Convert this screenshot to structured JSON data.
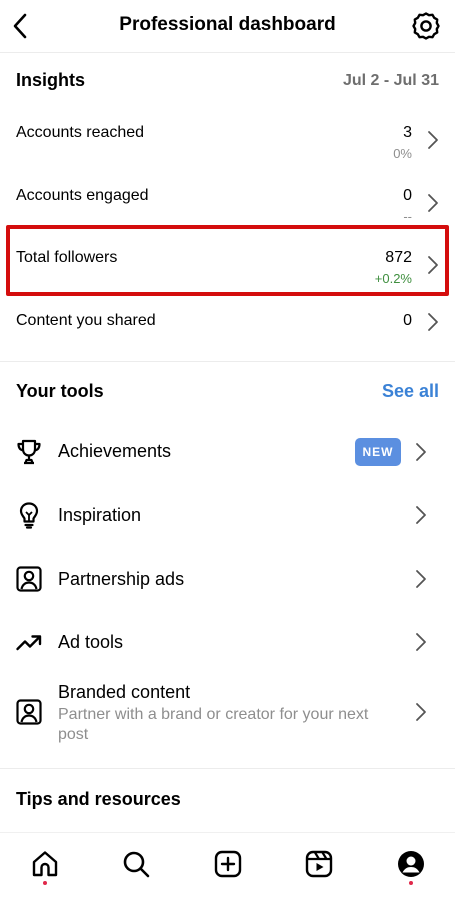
{
  "header": {
    "title": "Professional dashboard"
  },
  "insights": {
    "heading": "Insights",
    "date_range": "Jul 2 - Jul 31",
    "metrics": [
      {
        "label": "Accounts reached",
        "value": "3",
        "change": "0%"
      },
      {
        "label": "Accounts engaged",
        "value": "0",
        "change": "--"
      },
      {
        "label": "Total followers",
        "value": "872",
        "change": "+0.2%"
      },
      {
        "label": "Content you shared",
        "value": "0",
        "change": ""
      }
    ]
  },
  "tools": {
    "heading": "Your tools",
    "see_all": "See all",
    "items": [
      {
        "label": "Achievements",
        "badge": "NEW",
        "icon": "trophy-icon"
      },
      {
        "label": "Inspiration",
        "icon": "lightbulb-icon"
      },
      {
        "label": "Partnership ads",
        "icon": "person-card-icon"
      },
      {
        "label": "Ad tools",
        "icon": "trending-up-icon"
      },
      {
        "label": "Branded content",
        "description": "Partner with a brand or creator for your next post",
        "icon": "person-card-icon"
      }
    ]
  },
  "resources": {
    "heading": "Tips and resources"
  },
  "colors": {
    "accent_blue": "#3b82d6",
    "badge_blue": "#5b8fe0",
    "positive_green": "#3f8f3f",
    "highlight_red": "#d40d0d",
    "notification_dot": "#e0284a"
  }
}
